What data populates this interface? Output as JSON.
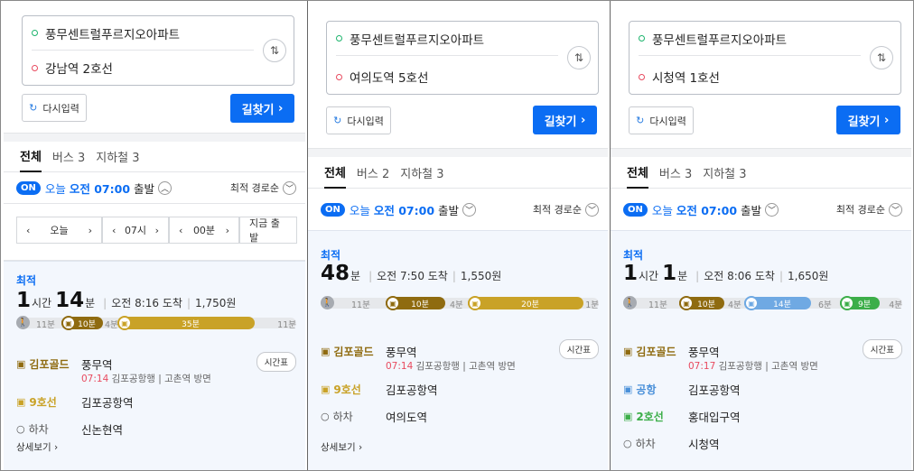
{
  "common": {
    "reset_label": "다시입력",
    "go_label": "길찾기",
    "tab_all": "전체",
    "on_badge": "ON",
    "today": "오늘",
    "depart_time": "오전 07:00",
    "depart_suffix": "출발",
    "sort_label": "최적 경로순",
    "best_label": "최적",
    "timetable": "시간표",
    "detail": "상세보기",
    "colors": {
      "accent": "#0b6df3",
      "gold": "#c9a227",
      "brown": "#8f6b10",
      "light_blue": "#6fa9e3",
      "green": "#3cae49"
    }
  },
  "panels": [
    {
      "origin": "풍무센트럴푸르지오아파트",
      "destination": "강남역 2호선",
      "tab_bus": "버스 3",
      "tab_subway": "지하철 3",
      "timebar": {
        "day": "오늘",
        "hour": "07시",
        "minute": "00분",
        "now": "지금 출발"
      },
      "summary": {
        "h": "1",
        "h_unit": "시간",
        "m": "14",
        "m_unit": "분",
        "arrive": "오전 8:16 도착",
        "fare": "1,750원"
      },
      "segments": {
        "walk1": "11분",
        "s1": "10분",
        "walk2": "4분",
        "s2": "35분",
        "walk3": "11분"
      },
      "steps": [
        {
          "line": "김포골드",
          "station": "풍무역",
          "time": "07:14",
          "dir": "김포공항행",
          "towards": "고촌역 방면"
        },
        {
          "line": "9호선",
          "station": "김포공항역"
        },
        {
          "line": "하차",
          "station": "신논현역"
        }
      ]
    },
    {
      "origin": "풍무센트럴푸르지오아파트",
      "destination": "여의도역 5호선",
      "tab_bus": "버스 2",
      "tab_subway": "지하철 3",
      "summary": {
        "m": "48",
        "m_unit": "분",
        "arrive": "오전 7:50 도착",
        "fare": "1,550원"
      },
      "segments": {
        "walk1": "11분",
        "s1": "10분",
        "walk2": "4분",
        "s2": "20분",
        "walk3": "1분"
      },
      "steps": [
        {
          "line": "김포골드",
          "station": "풍무역",
          "time": "07:14",
          "dir": "김포공항행",
          "towards": "고촌역 방면"
        },
        {
          "line": "9호선",
          "station": "김포공항역"
        },
        {
          "line": "하차",
          "station": "여의도역"
        }
      ]
    },
    {
      "origin": "풍무센트럴푸르지오아파트",
      "destination": "시청역 1호선",
      "tab_bus": "버스 3",
      "tab_subway": "지하철 3",
      "summary": {
        "h": "1",
        "h_unit": "시간",
        "m": "1",
        "m_unit": "분",
        "arrive": "오전 8:06 도착",
        "fare": "1,650원"
      },
      "segments": {
        "walk1": "11분",
        "s1": "10분",
        "walk2": "4분",
        "s2": "14분",
        "walk3": "6분",
        "s3": "9분",
        "walk4": "4분"
      },
      "steps": [
        {
          "line": "김포골드",
          "station": "풍무역",
          "time": "07:17",
          "dir": "김포공항행",
          "towards": "고촌역 방면"
        },
        {
          "line": "공항",
          "station": "김포공항역"
        },
        {
          "line": "2호선",
          "station": "홍대입구역"
        },
        {
          "line": "하차",
          "station": "시청역"
        }
      ]
    }
  ]
}
